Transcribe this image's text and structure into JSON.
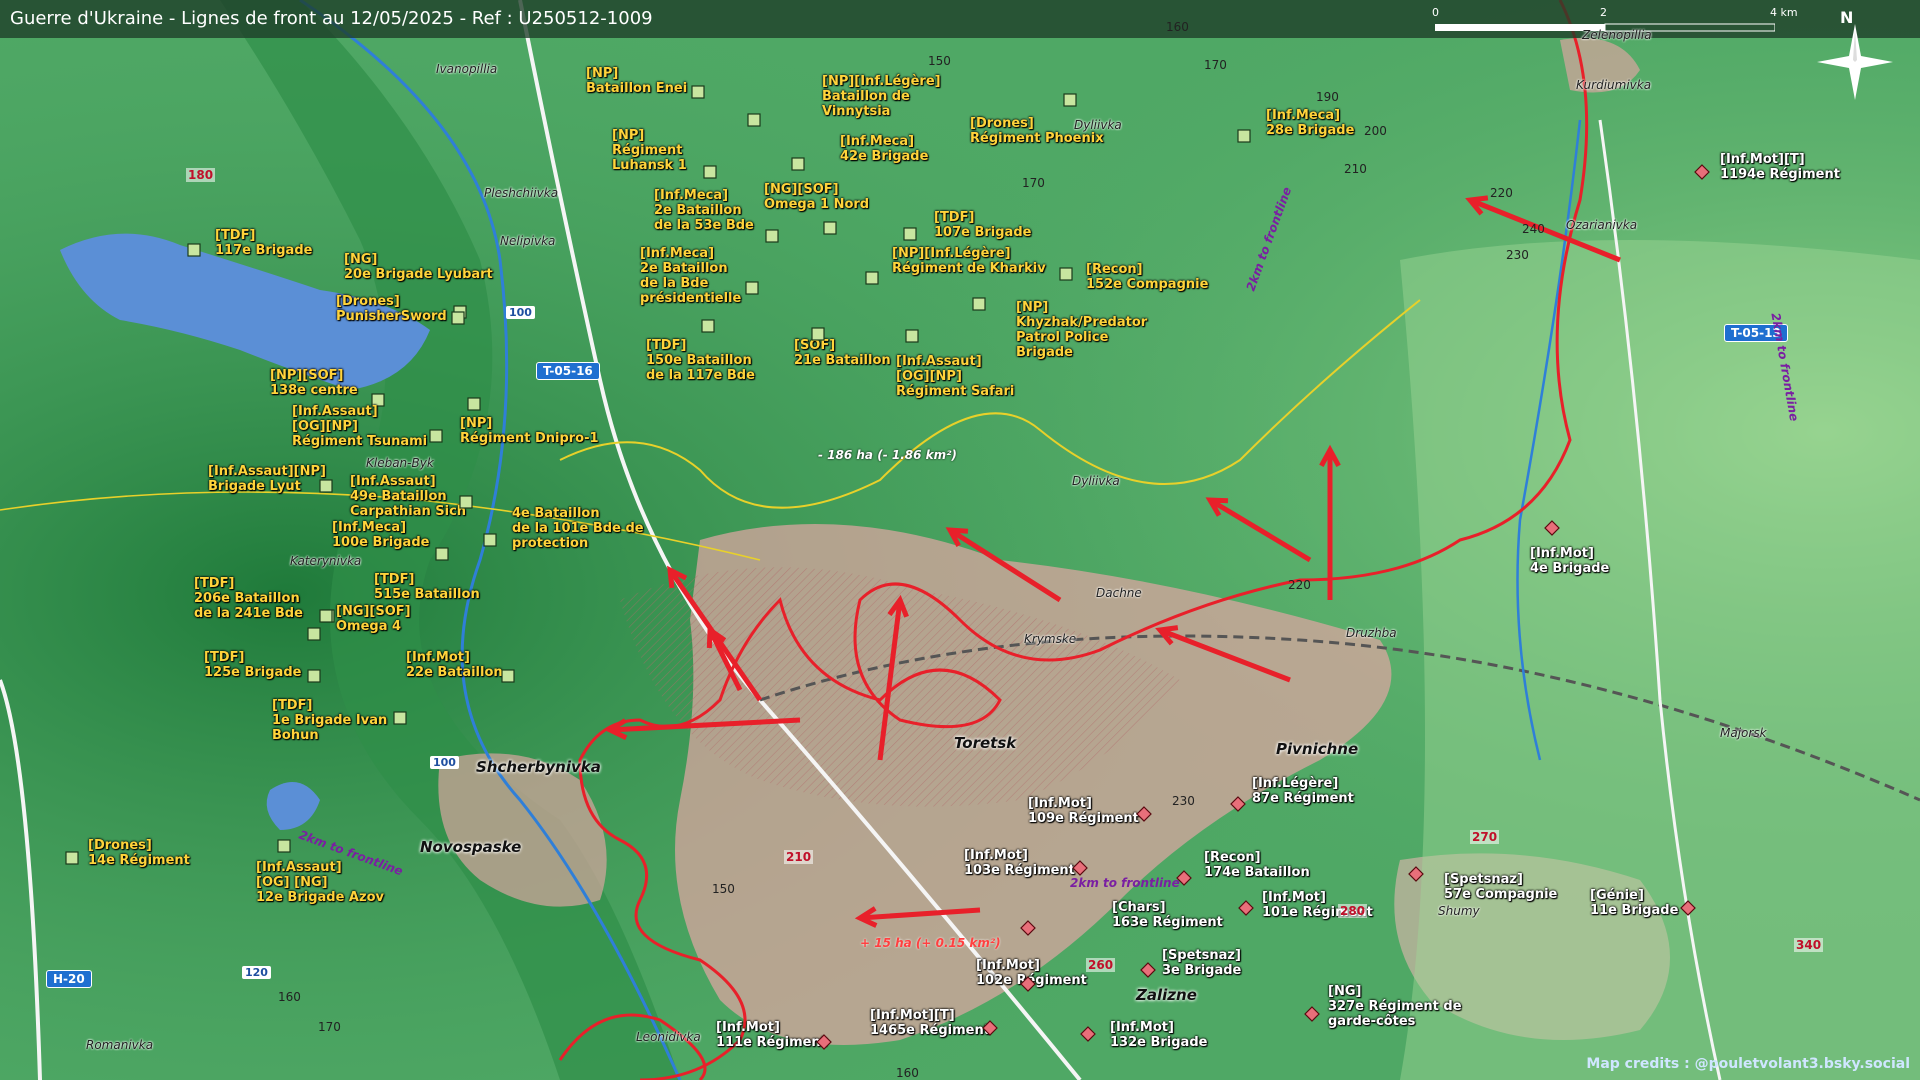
{
  "header": {
    "title": "Guerre d'Ukraine - Lignes de front au 12/05/2025 - Ref : U250512-1009",
    "scale": [
      "0",
      "2",
      "4 km"
    ],
    "north": "N"
  },
  "credits": "Map credits : @pouletvolant3.bsky.social",
  "colors": {
    "front_line": "#e8202a",
    "ua_unit": "#c8e6a0",
    "ru_unit": "#e86f7a",
    "label": "#ffd43b",
    "road": "#1f6fd0"
  },
  "ua_units": [
    {
      "label": "[NP]\nBataillon Enei",
      "icon": "unit-square-icon"
    },
    {
      "label": "[NP][Inf.Légère]\nBataillon de\nVinnytsia",
      "icon": "unit-square-icon"
    },
    {
      "label": "[NP]\nRégiment\nLuhansk 1",
      "icon": "unit-square-icon"
    },
    {
      "label": "[Inf.Meca]\n42e Brigade",
      "icon": "unit-square-icon"
    },
    {
      "label": "[Drones]\nRégiment Phoenix",
      "icon": "unit-square-icon"
    },
    {
      "label": "[Inf.Meca]\n28e Brigade",
      "icon": "unit-square-icon"
    },
    {
      "label": "[NG][SOF]\nOmega 1 Nord",
      "icon": "unit-square-icon"
    },
    {
      "label": "[Inf.Meca]\n2e Bataillon\nde la 53e Bde",
      "icon": "unit-square-icon"
    },
    {
      "label": "[TDF]\n107e Brigade",
      "icon": "unit-square-icon"
    },
    {
      "label": "[TDF]\n117e Brigade",
      "icon": "unit-square-icon"
    },
    {
      "label": "[NG]\n20e Brigade Lyubart",
      "icon": "unit-square-icon"
    },
    {
      "label": "[Inf.Meca]\n2e Bataillon\nde la Bde\nprésidentielle",
      "icon": "unit-square-icon"
    },
    {
      "label": "[NP][Inf.Légère]\nRégiment de Kharkiv",
      "icon": "unit-square-icon"
    },
    {
      "label": "[Recon]\n152e Compagnie",
      "icon": "unit-square-icon"
    },
    {
      "label": "[Drones]\nPunisherSword",
      "icon": "unit-square-icon"
    },
    {
      "label": "[NP]\nKhyzhak/Predator\nPatrol Police\nBrigade",
      "icon": "unit-square-icon"
    },
    {
      "label": "[SOF]\n21e Bataillon",
      "icon": "unit-square-icon"
    },
    {
      "label": "[TDF]\n150e Bataillon\nde la 117e Bde",
      "icon": "unit-square-icon"
    },
    {
      "label": "[Inf.Assaut]\n[OG][NP]\nRégiment Safari",
      "icon": "unit-square-icon"
    },
    {
      "label": "[NP][SOF]\n138e centre",
      "icon": "unit-square-icon"
    },
    {
      "label": "[NP]\nRégiment Dnipro-1",
      "icon": "unit-square-icon"
    },
    {
      "label": "[Inf.Assaut]\n[OG][NP]\nRégiment Tsunami",
      "icon": "unit-square-icon"
    },
    {
      "label": "[Inf.Assaut][NP]\nBrigade Lyut",
      "icon": "unit-square-icon"
    },
    {
      "label": "[Inf.Assaut]\n49e Bataillon\nCarpathian Sich",
      "icon": "unit-square-icon"
    },
    {
      "label": "4e Bataillon\nde la 101e Bde de\nprotection",
      "icon": "unit-square-icon"
    },
    {
      "label": "[Inf.Meca]\n100e Brigade",
      "icon": "unit-square-icon"
    },
    {
      "label": "[TDF]\n206e Bataillon\nde la 241e Bde",
      "icon": "unit-square-icon"
    },
    {
      "label": "[TDF]\n515e Bataillon",
      "icon": "unit-square-icon"
    },
    {
      "label": "[NG][SOF]\nOmega 4",
      "icon": "unit-square-icon"
    },
    {
      "label": "[TDF]\n125e Brigade",
      "icon": "unit-square-icon"
    },
    {
      "label": "[Inf.Mot]\n22e Bataillon",
      "icon": "unit-square-icon"
    },
    {
      "label": "[TDF]\n1e Brigade Ivan\nBohun",
      "icon": "unit-square-icon"
    },
    {
      "label": "[Drones]\n14e Régiment",
      "icon": "unit-square-icon"
    },
    {
      "label": "[Inf.Assaut]\n[OG] [NG]\n12e Brigade Azov",
      "icon": "unit-square-icon"
    }
  ],
  "ru_units": [
    {
      "label": "[Inf.Mot][T]\n1194e Régiment",
      "icon": "unit-diamond-icon"
    },
    {
      "label": "[Inf.Mot]\n4e Brigade",
      "icon": "unit-diamond-icon"
    },
    {
      "label": "[Inf.Mot]\n109e Régiment",
      "icon": "unit-diamond-icon"
    },
    {
      "label": "[Inf.Légère]\n87e Régiment",
      "icon": "unit-diamond-icon"
    },
    {
      "label": "[Inf.Mot]\n103e Régiment",
      "icon": "unit-diamond-icon"
    },
    {
      "label": "[Recon]\n174e Bataillon",
      "icon": "unit-diamond-icon"
    },
    {
      "label": "[Spetsnaz]\n57e Compagnie",
      "icon": "unit-diamond-icon"
    },
    {
      "label": "[Génie]\n11e Brigade",
      "icon": "unit-diamond-icon"
    },
    {
      "label": "[Chars]\n163e Régiment",
      "icon": "unit-diamond-icon"
    },
    {
      "label": "[Inf.Mot]\n101e Régiment",
      "icon": "unit-diamond-icon"
    },
    {
      "label": "[Spetsnaz]\n3e Brigade",
      "icon": "unit-diamond-icon"
    },
    {
      "label": "[Inf.Mot]\n102e Régiment",
      "icon": "unit-diamond-icon"
    },
    {
      "label": "[NG]\n327e Régiment de\ngarde-côtes",
      "icon": "unit-diamond-icon"
    },
    {
      "label": "[Inf.Mot]\n132e Brigade",
      "icon": "unit-diamond-icon"
    },
    {
      "label": "[Inf.Mot][T]\n1465e Régiment",
      "icon": "unit-diamond-icon"
    },
    {
      "label": "[Inf.Mot]\n111e Régiment",
      "icon": "unit-diamond-icon"
    }
  ],
  "towns": [
    "Toretsk",
    "Pivnichne",
    "Shcherbynivka",
    "Novospaske",
    "Zalizne"
  ],
  "places": [
    "Ivanopillia",
    "Pleshchiivka",
    "Nelipivka",
    "Kleban-Byk",
    "Katerynivka",
    "Dyliivka",
    "Dyliivka",
    "Dachne",
    "Krymske",
    "Druzhba",
    "Ozarianivka",
    "Kurdiumivka",
    "Zelenopillia",
    "Majorsk",
    "Shumy",
    "Leonidivka",
    "Romanivka"
  ],
  "roads": [
    "T-05-16",
    "T-05-13",
    "H-20"
  ],
  "road_numbers": [
    "100",
    "100",
    "120"
  ],
  "elevations": [
    "150",
    "160",
    "170",
    "190",
    "200",
    "170",
    "210",
    "220",
    "240",
    "230",
    "220",
    "150",
    "230",
    "160",
    "170",
    "160"
  ],
  "elevations_red": [
    "180",
    "210",
    "270",
    "280",
    "260",
    "340"
  ],
  "front_labels": [
    "2km to frontline",
    "2km to frontline",
    "2km to frontline",
    "2km to frontline"
  ],
  "areas": {
    "gain_ru": "- 186 ha (- 1.86 km²)",
    "gain_red": "+ 15 ha (+ 0.15 km²)"
  }
}
